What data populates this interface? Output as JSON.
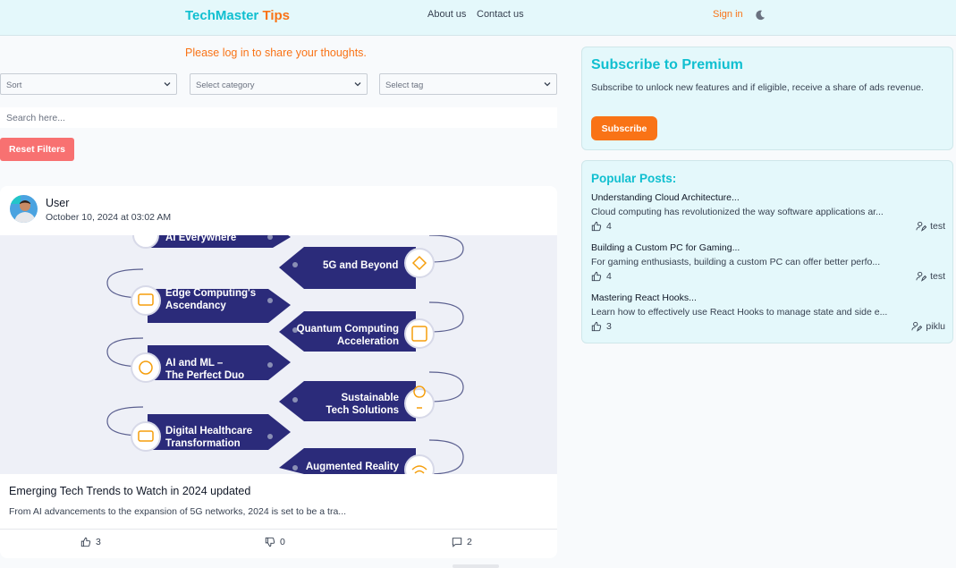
{
  "header": {
    "logo_part1": "TechMaster",
    "logo_part2": "Tips",
    "nav": [
      "About us",
      "Contact us"
    ],
    "signin": "Sign in",
    "theme_icon": "moon-icon"
  },
  "feed": {
    "login_message": "Please log in to share your thoughts.",
    "filters": {
      "sort": "Sort",
      "category": "Select category",
      "tag": "Select tag"
    },
    "search_placeholder": "Search here...",
    "reset_label": "Reset Filters",
    "post": {
      "author": "User",
      "date": "October 10, 2024 at 03:02 AM",
      "title": "Emerging Tech Trends to Watch in 2024 updated",
      "excerpt": "From AI advancements to the expansion of 5G networks, 2024 is set to be a tra...",
      "likes": "3",
      "dislikes": "0",
      "comments": "2",
      "image_items": [
        "AI Everywhere",
        "5G and Beyond",
        "Edge Computing's",
        "Ascendancy",
        "Quantum Computing",
        "Acceleration",
        "AI and ML –",
        "The Perfect Duo",
        "Sustainable",
        "Tech Solutions",
        "Digital Healthcare",
        "Transformation",
        "Augmented Reality"
      ]
    }
  },
  "sidebar": {
    "premium": {
      "title": "Subscribe to Premium",
      "description": "Subscribe to unlock new features and if eligible, receive a share of ads revenue.",
      "button": "Subscribe"
    },
    "popular": {
      "title": "Popular Posts:",
      "posts": [
        {
          "title": "Understanding Cloud Architecture...",
          "excerpt": "Cloud computing has revolutionized the way software applications ar...",
          "likes": "4",
          "author": "test"
        },
        {
          "title": "Building a Custom PC for Gaming...",
          "excerpt": "For gaming enthusiasts, building a custom PC can offer better perfo...",
          "likes": "4",
          "author": "test"
        },
        {
          "title": "Mastering React Hooks...",
          "excerpt": "Learn how to effectively use React Hooks to manage state and side e...",
          "likes": "3",
          "author": "piklu"
        }
      ]
    }
  },
  "colors": {
    "brand_cyan": "#10bfd0",
    "brand_orange": "#f97316",
    "reset_red": "#f87171",
    "infographic_navy": "#2b2b7a"
  }
}
